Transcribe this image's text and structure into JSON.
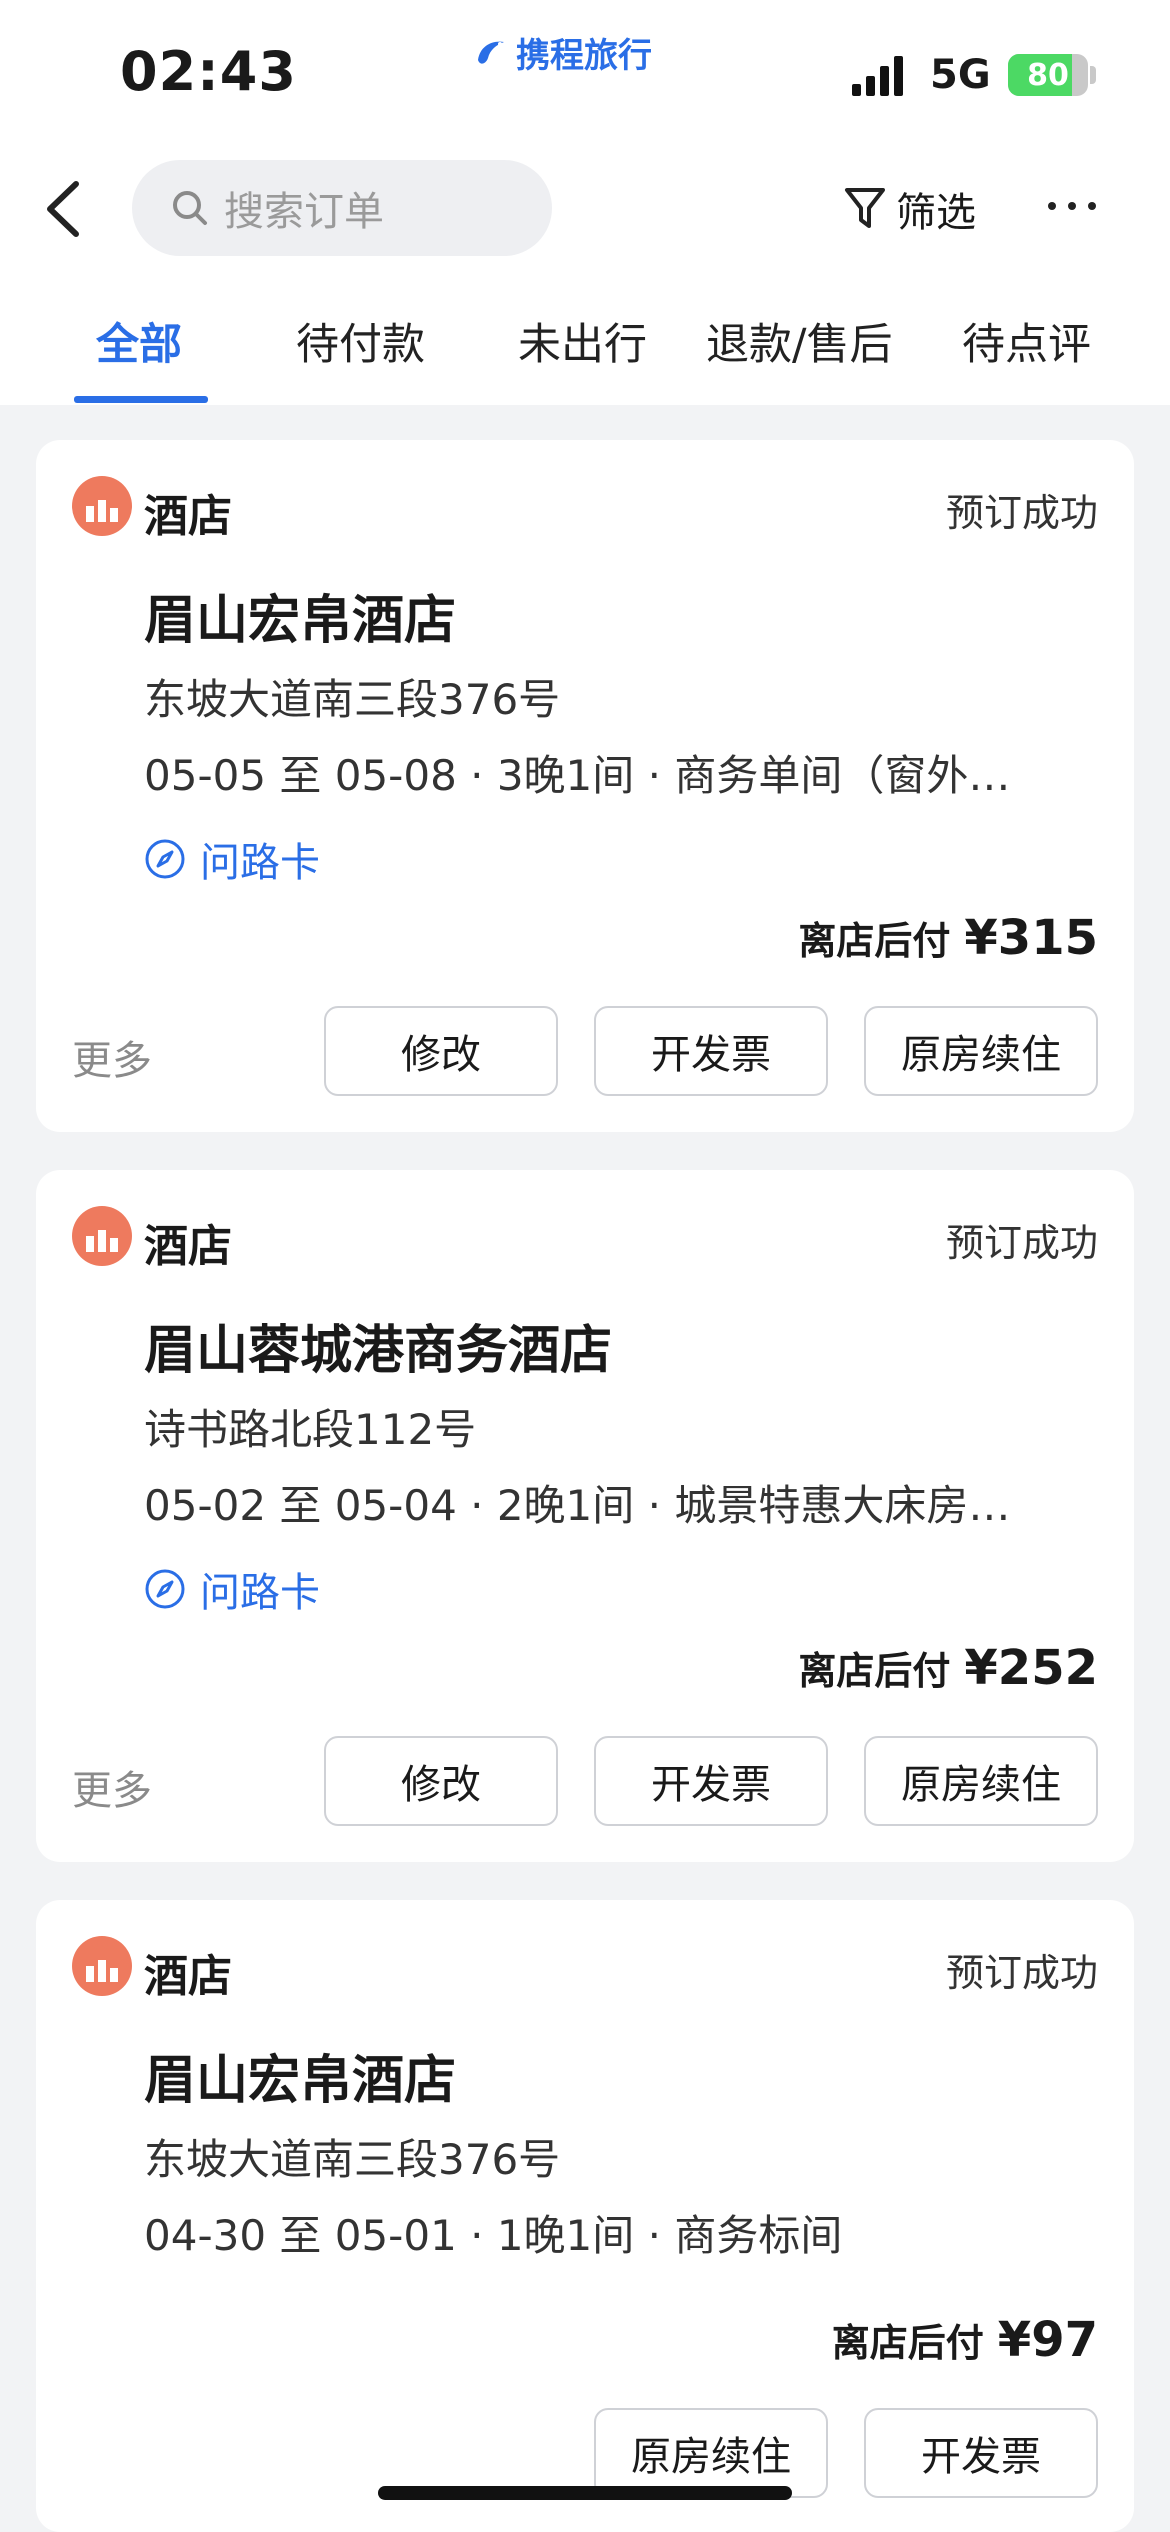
{
  "status_bar": {
    "time": "02:43",
    "brand": "携程旅行",
    "network": "5G",
    "battery": "80",
    "battery_level": 0.8,
    "battery_color": "#4cd964"
  },
  "nav": {
    "back_icon": "chevron-left-icon",
    "search_placeholder": "搜索订单",
    "filter_label": "筛选",
    "more_icon": "ellipsis-icon"
  },
  "tabs": [
    {
      "label": "全部",
      "active": true
    },
    {
      "label": "待付款",
      "active": false
    },
    {
      "label": "未出行",
      "active": false
    },
    {
      "label": "退款/售后",
      "active": false
    },
    {
      "label": "待点评",
      "active": false
    }
  ],
  "colors": {
    "accent": "#2a6ee6",
    "hotel_icon": "#ee7a5e"
  },
  "orders": [
    {
      "category": "酒店",
      "status": "预订成功",
      "hotel": "眉山宏帛酒店",
      "address": "东坡大道南三段376号",
      "details": "05-05 至 05-08 · 3晚1间 · 商务单间（窗外…",
      "route_card": "问路卡",
      "price_label": "离店后付",
      "price": "¥315",
      "more": "更多",
      "buttons": [
        "修改",
        "开发票",
        "原房续住"
      ]
    },
    {
      "category": "酒店",
      "status": "预订成功",
      "hotel": "眉山蓉城港商务酒店",
      "address": "诗书路北段112号",
      "details": "05-02 至 05-04 · 2晚1间 · 城景特惠大床房…",
      "route_card": "问路卡",
      "price_label": "离店后付",
      "price": "¥252",
      "more": "更多",
      "buttons": [
        "修改",
        "开发票",
        "原房续住"
      ]
    },
    {
      "category": "酒店",
      "status": "预订成功",
      "hotel": "眉山宏帛酒店",
      "address": "东坡大道南三段376号",
      "details": "04-30 至 05-01 · 1晚1间 · 商务标间",
      "price_label": "离店后付",
      "price": "¥97",
      "buttons": [
        "原房续住",
        "开发票"
      ]
    }
  ]
}
